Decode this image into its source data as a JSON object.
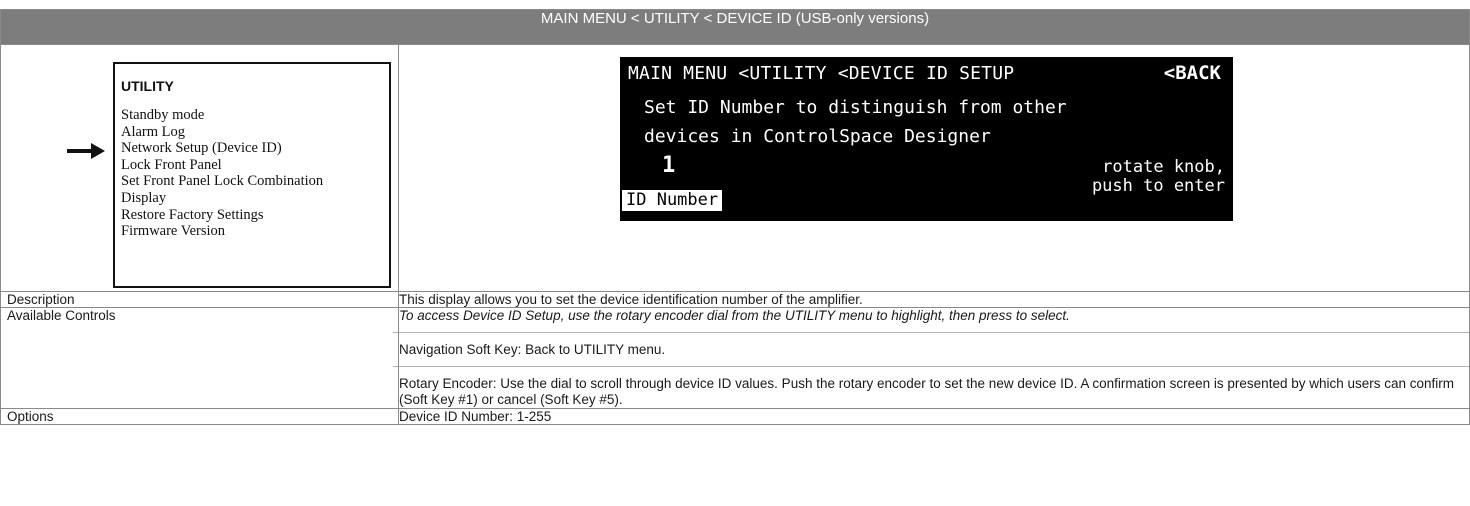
{
  "header": {
    "title": "MAIN MENU < UTILITY < DEVICE ID (USB-only versions)"
  },
  "menu": {
    "title": "UTILITY",
    "items": [
      "Standby mode",
      "Alarm Log",
      "Network Setup (Device ID)",
      "Lock Front Panel",
      "Set Front Panel Lock Combination",
      "Display",
      "Restore Factory Settings",
      "Firmware Version"
    ],
    "selected_item": "Network Setup (Device ID)",
    "pointer_icon": "right-arrow-icon"
  },
  "lcd": {
    "title": "MAIN MENU <UTILITY <DEVICE ID SETUP",
    "back": "<BACK",
    "line1": "Set ID Number to distinguish from other",
    "line2": "devices in ControlSpace Designer",
    "value": "1",
    "hint1": "rotate knob,",
    "hint2": "push to enter",
    "selected_label": "ID Number"
  },
  "rows": {
    "description": {
      "label": "Description",
      "text": "This display allows you to set the device identification number of the amplifier."
    },
    "controls": {
      "label": "Available Controls",
      "p1": "To access Device ID Setup, use the rotary encoder dial from the UTILITY menu to highlight, then press to select.",
      "p2": "Navigation Soft Key: Back to UTILITY menu.",
      "p3": "Rotary Encoder: Use the dial to scroll through device ID values. Push the rotary encoder to set the new device ID. A confirmation screen is presented by which users can confirm (Soft Key #1) or cancel (Soft Key #5)."
    },
    "options": {
      "label": "Options",
      "text": "Device ID Number: 1-255"
    }
  },
  "colors": {
    "header_bg": "#7d7d7d",
    "lcd_bg": "#000000",
    "border": "#8a8a8a"
  }
}
